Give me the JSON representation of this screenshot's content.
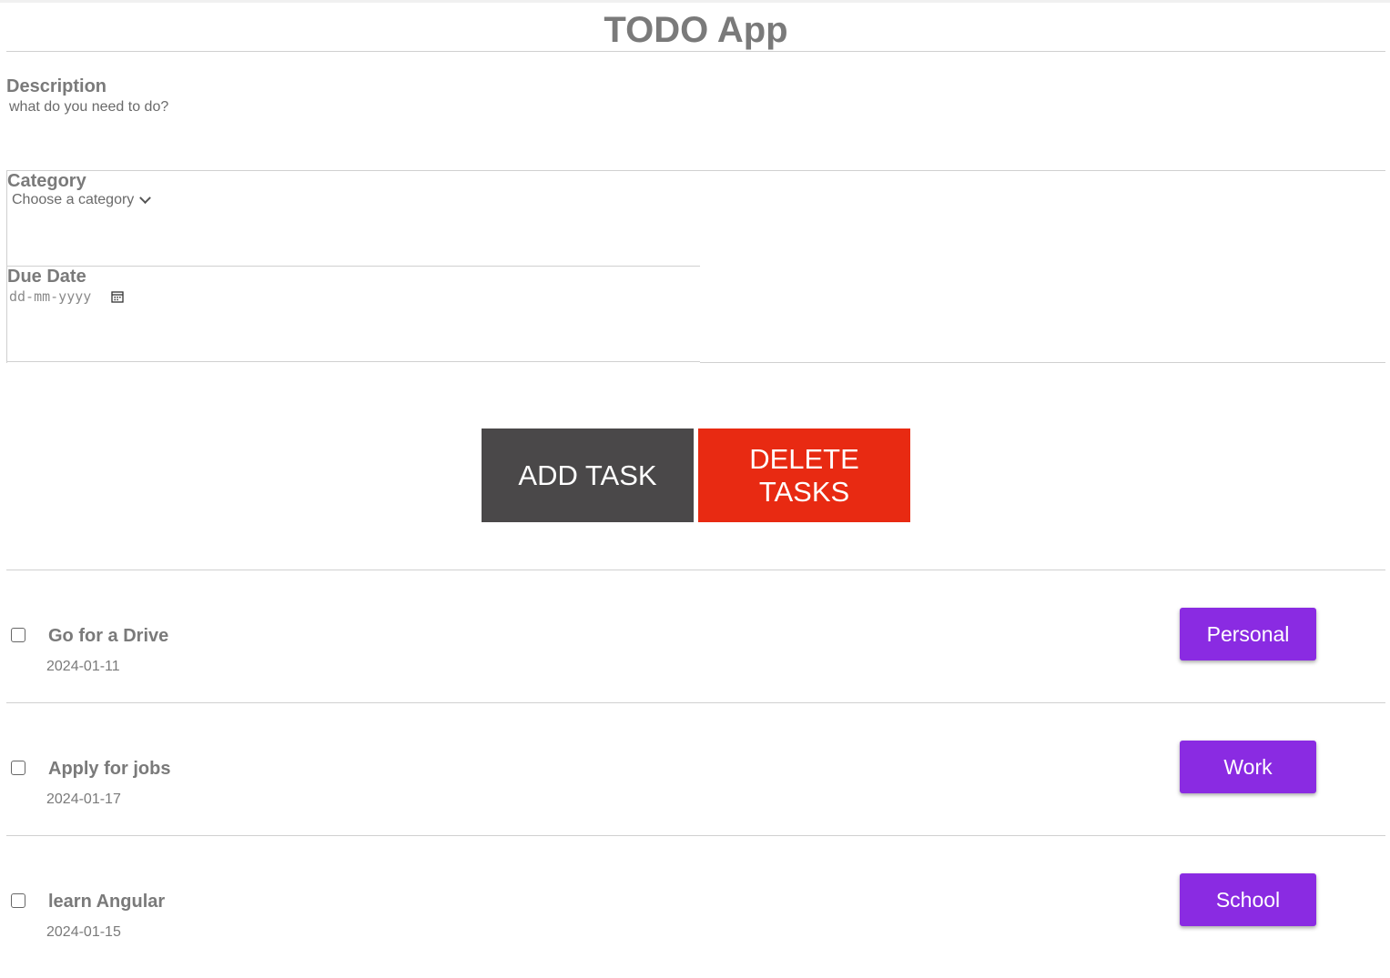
{
  "app": {
    "title": "TODO App"
  },
  "form": {
    "description": {
      "label": "Description",
      "value": "",
      "placeholder": "what do you need to do?"
    },
    "category": {
      "label": "Category",
      "selected": "Choose a category"
    },
    "due_date": {
      "label": "Due Date",
      "placeholder": "dd-mm-yyyy"
    }
  },
  "actions": {
    "add_label": "ADD TASK",
    "delete_label": "DELETE TASKS"
  },
  "tasks": [
    {
      "title": "Go for a Drive",
      "date": "2024-01-11",
      "category": "Personal",
      "done": false
    },
    {
      "title": "Apply for jobs",
      "date": "2024-01-17",
      "category": "Work",
      "done": false
    },
    {
      "title": "learn Angular",
      "date": "2024-01-15",
      "category": "School",
      "done": false
    }
  ],
  "colors": {
    "add_button": "#4a4849",
    "delete_button": "#e82a12",
    "category_badge": "#8a2be2",
    "text": "#7a7a7a"
  }
}
